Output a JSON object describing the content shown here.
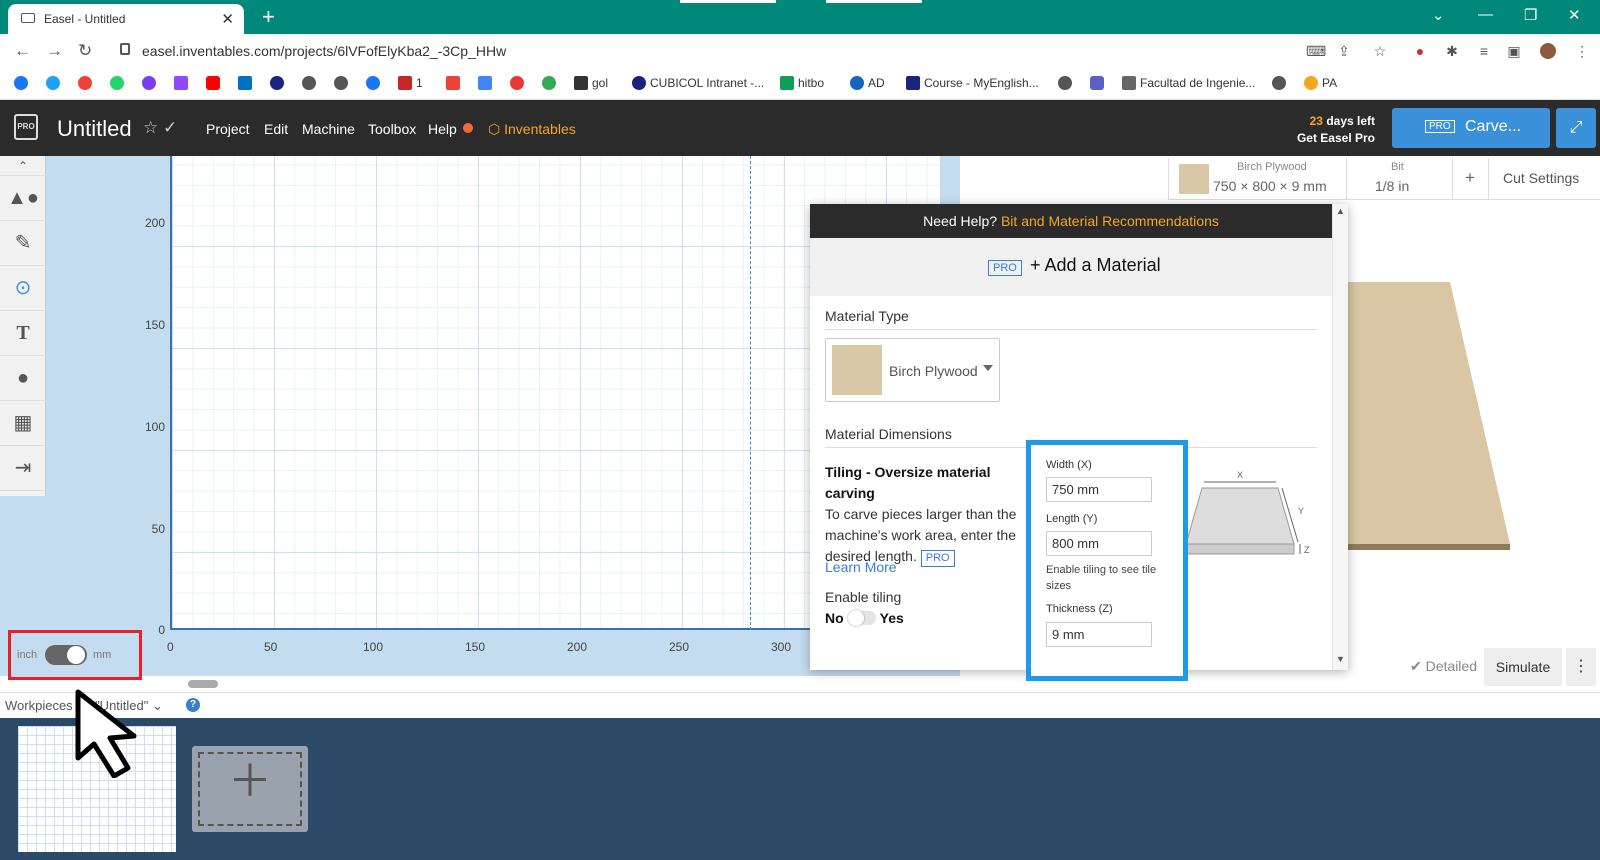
{
  "browser": {
    "tab_title": "Easel - Untitled",
    "url": "easel.inventables.com/projects/6lVFofElyKba2_-3Cp_HHw",
    "bookmarks": [
      {
        "label": "1",
        "color": "#c62828"
      },
      {
        "label": "gol",
        "color": "#333333"
      },
      {
        "label": "CUBICOL Intranet -...",
        "color": "#1a237e"
      },
      {
        "label": "hitbo",
        "color": "#0f9d58"
      },
      {
        "label": "AD",
        "color": "#1565c0"
      },
      {
        "label": "Course - MyEnglish...",
        "color": "#1a237e"
      },
      {
        "label": "Facultad de Ingenie...",
        "color": "#666666"
      },
      {
        "label": "PA",
        "color": "#f6a623"
      }
    ]
  },
  "header": {
    "project_title": "Untitled",
    "menu": [
      "Project",
      "Edit",
      "Machine",
      "Toolbox",
      "Help"
    ],
    "inventables": "Inventables",
    "trial_days": "23",
    "trial_days_suffix": "days left",
    "trial_cta": "Get Easel Pro",
    "carve_pro_badge": "PRO",
    "carve_label": "Carve..."
  },
  "canvas": {
    "y_ticks": [
      "200",
      "150",
      "100",
      "50",
      "0"
    ],
    "x_ticks": [
      "0",
      "50",
      "100",
      "150",
      "200",
      "250",
      "300"
    ],
    "unit_left": "inch",
    "unit_right": "mm"
  },
  "material_bar": {
    "material_name": "Birch Plywood",
    "material_dims": "750 × 800 × 9 mm",
    "bit_label": "Bit",
    "bit_value": "1/8 in",
    "add": "+",
    "cut_settings": "Cut Settings"
  },
  "modal": {
    "help_prefix": "Need Help?",
    "help_link": "Bit and Material Recommendations",
    "pro_badge": "PRO",
    "add_material": "+ Add a Material",
    "material_type": "Material Type",
    "selected_material": "Birch Plywood",
    "material_dimensions": "Material Dimensions",
    "tiling_title": "Tiling - Oversize material carving",
    "tiling_desc": "To carve pieces larger than the machine's work area, enter the desired length.",
    "learn_more": "Learn More",
    "enable_tiling": "Enable tiling",
    "no": "No",
    "yes": "Yes",
    "width_label": "Width (X)",
    "width_value": "750 mm",
    "length_label": "Length (Y)",
    "length_value": "800 mm",
    "tiling_note": "Enable tiling to see tile sizes",
    "thickness_label": "Thickness (Z)",
    "thickness_value": "9 mm",
    "diagram_x": "X",
    "diagram_y": "Y",
    "diagram_z": "Z"
  },
  "preview_footer": {
    "detailed": "Detailed",
    "simulate": "Simulate"
  },
  "workpieces": {
    "label": "Workpieces for \"Untitled\""
  },
  "colors": {
    "browser_accent": "#00897b",
    "carve_button": "#3a90d9",
    "highlight_red": "#e8202a",
    "highlight_blue": "#1d9be6",
    "inventables_orange": "#f6a623"
  }
}
